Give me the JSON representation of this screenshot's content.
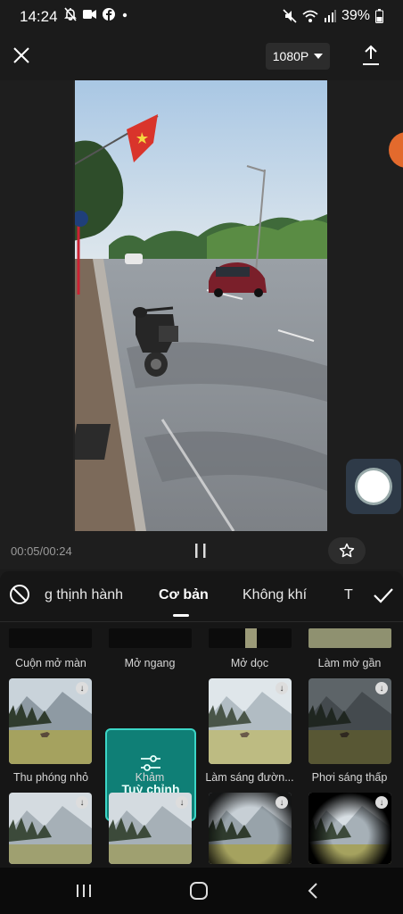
{
  "status": {
    "time": "14:24",
    "battery": "39%",
    "left_icons": [
      "mute-icon",
      "video-icon",
      "facebook-icon",
      "dot-icon"
    ],
    "right_icons": [
      "mute-icon",
      "wifi-icon",
      "signal-icon",
      "battery-icon"
    ]
  },
  "toolbar": {
    "resolution": "1080P"
  },
  "playback": {
    "time": "00:05/00:24"
  },
  "categories": {
    "tabs": [
      "g thịnh hành",
      "Cơ bản",
      "Không khí",
      "Tì"
    ],
    "active": "Cơ bản"
  },
  "effects": {
    "row1": [
      "Cuộn mở màn",
      "Mở ngang",
      "Mở dọc",
      "Làm mờ gần"
    ],
    "row2": [
      "Thu phóng nhỏ",
      "Khảm",
      "Làm sáng đườn...",
      "Phơi sáng thấp"
    ],
    "selected_label": "Tuỳ chỉnh"
  },
  "colors": {
    "accent": "#3bd6c6",
    "selected_bg": "#0f7f76",
    "record_dot": "#e36a2d"
  }
}
